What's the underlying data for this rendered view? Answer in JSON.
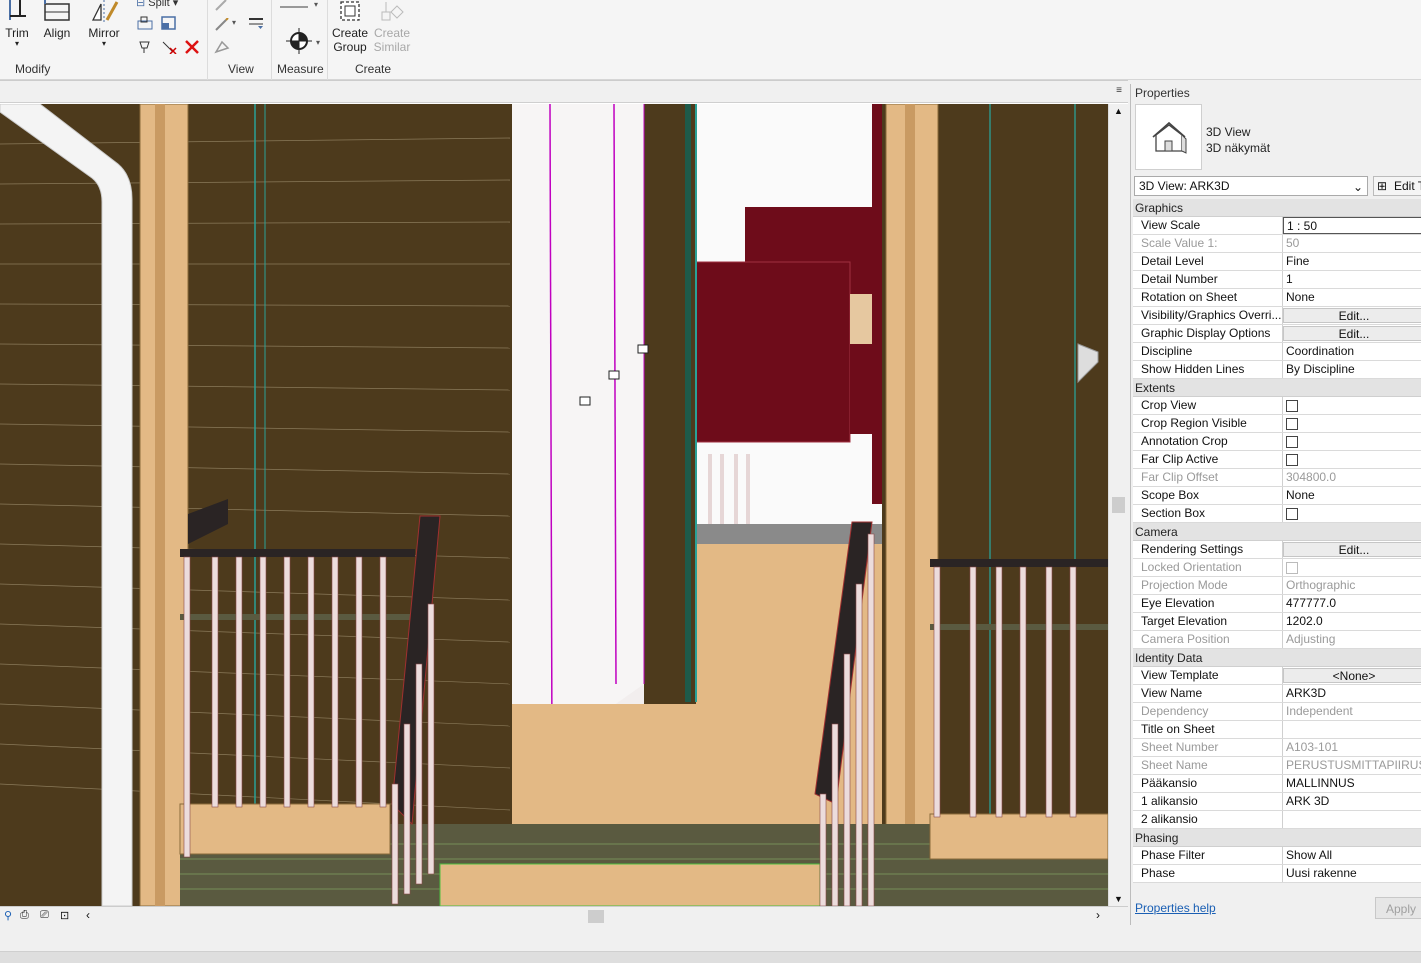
{
  "ribbon": {
    "buttons": {
      "trim": "Trim",
      "align": "Align",
      "mirror": "Mirror",
      "split": "Split",
      "create_group_line1": "Create",
      "create_group_line2": "Group",
      "create_similar_line1": "Create",
      "create_similar_line2": "Similar"
    },
    "groups": {
      "modify": "Modify",
      "view": "View",
      "measure": "Measure",
      "create": "Create"
    }
  },
  "properties": {
    "title": "Properties",
    "type_line1": "3D View",
    "type_line2": "3D näkymät",
    "view_selector": "3D View: ARK3D",
    "edit_type": "Edit Type",
    "help_link": "Properties help",
    "apply": "Apply",
    "sections": {
      "graphics": "Graphics",
      "extents": "Extents",
      "camera": "Camera",
      "identity": "Identity Data",
      "phasing": "Phasing"
    },
    "graphics": {
      "view_scale_k": "View Scale",
      "view_scale_v": "1 : 50",
      "scale_value_k": "Scale Value    1:",
      "scale_value_v": "50",
      "detail_level_k": "Detail Level",
      "detail_level_v": "Fine",
      "detail_number_k": "Detail Number",
      "detail_number_v": "1",
      "rotation_k": "Rotation on Sheet",
      "rotation_v": "None",
      "vg_k": "Visibility/Graphics Overri...",
      "vg_v": "Edit...",
      "gdo_k": "Graphic Display Options",
      "gdo_v": "Edit...",
      "discipline_k": "Discipline",
      "discipline_v": "Coordination",
      "hidden_lines_k": "Show Hidden Lines",
      "hidden_lines_v": "By Discipline"
    },
    "extents": {
      "crop_view_k": "Crop View",
      "crop_view_v": false,
      "crop_region_k": "Crop Region Visible",
      "crop_region_v": false,
      "annotation_crop_k": "Annotation Crop",
      "annotation_crop_v": false,
      "far_clip_active_k": "Far Clip Active",
      "far_clip_active_v": false,
      "far_clip_offset_k": "Far Clip Offset",
      "far_clip_offset_v": "304800.0",
      "scope_box_k": "Scope Box",
      "scope_box_v": "None",
      "section_box_k": "Section Box",
      "section_box_v": false
    },
    "camera": {
      "rendering_k": "Rendering Settings",
      "rendering_v": "Edit...",
      "locked_k": "Locked Orientation",
      "locked_v": false,
      "projection_k": "Projection Mode",
      "projection_v": "Orthographic",
      "eye_k": "Eye Elevation",
      "eye_v": "477777.0",
      "target_k": "Target Elevation",
      "target_v": "1202.0",
      "position_k": "Camera Position",
      "position_v": "Adjusting"
    },
    "identity": {
      "template_k": "View Template",
      "template_v": "<None>",
      "name_k": "View Name",
      "name_v": "ARK3D",
      "dependency_k": "Dependency",
      "dependency_v": "Independent",
      "title_sheet_k": "Title on Sheet",
      "title_sheet_v": "",
      "sheet_number_k": "Sheet Number",
      "sheet_number_v": "A103-101",
      "sheet_name_k": "Sheet Name",
      "sheet_name_v": "PERUSTUSMITTAPIIRUSTU",
      "paakansio_k": "Pääkansio",
      "paakansio_v": "MALLINNUS",
      "alikansio1_k": "1 alikansio",
      "alikansio1_v": "ARK 3D",
      "alikansio2_k": "2 alikansio",
      "alikansio2_v": ""
    },
    "phasing": {
      "filter_k": "Phase Filter",
      "filter_v": "Show All",
      "phase_k": "Phase",
      "phase_v": "Uusi rakenne"
    }
  },
  "colors": {
    "wall_brown": "#4d3a1c",
    "floor_tan": "#e3b985",
    "furniture_red": "#6e0c1a",
    "handrail": "#2a2424",
    "baluster": "#ecdcdc",
    "accent_blue": "#1a5fb4"
  },
  "icons": {
    "trim": "trim-icon",
    "align": "align-icon",
    "mirror": "mirror-icon",
    "measure": "measure-icon",
    "create_group": "create-group-icon",
    "type_image": "house-3d-icon"
  }
}
